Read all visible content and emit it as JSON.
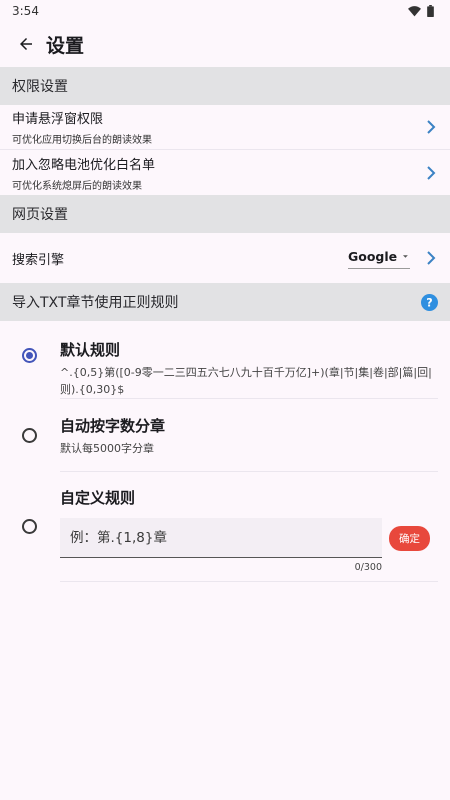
{
  "status_bar": {
    "time": "3:54"
  },
  "app_bar": {
    "title": "设置"
  },
  "sections": {
    "permissions": {
      "header": "权限设置",
      "items": [
        {
          "title": "申请悬浮窗权限",
          "subtitle": "可优化应用切换后台的朗读效果"
        },
        {
          "title": "加入忽略电池优化白名单",
          "subtitle": "可优化系统熄屏后的朗读效果"
        }
      ]
    },
    "web": {
      "header": "网页设置",
      "search_engine": {
        "label": "搜索引擎",
        "value": "Google"
      }
    },
    "txt_rules": {
      "header": "导入TXT章节使用正则规则",
      "rules": [
        {
          "title": "默认规则",
          "desc": "^.{0,5}第([0-9零一二三四五六七八九十百千万亿]+)(章|节|集|卷|部|篇|回|则).{0,30}$",
          "checked": true
        },
        {
          "title": "自动按字数分章",
          "desc": "默认每5000字分章",
          "checked": false
        }
      ],
      "custom": {
        "title": "自定义规则",
        "placeholder": "例：第.{1,8}章",
        "confirm_label": "确定",
        "counter": "0/300",
        "checked": false
      }
    }
  },
  "colors": {
    "accent_chevron": "#3b82c4",
    "help_icon": "#2f8fe0",
    "confirm_button": "#e8483c",
    "radio_checked": "#4355b9"
  }
}
